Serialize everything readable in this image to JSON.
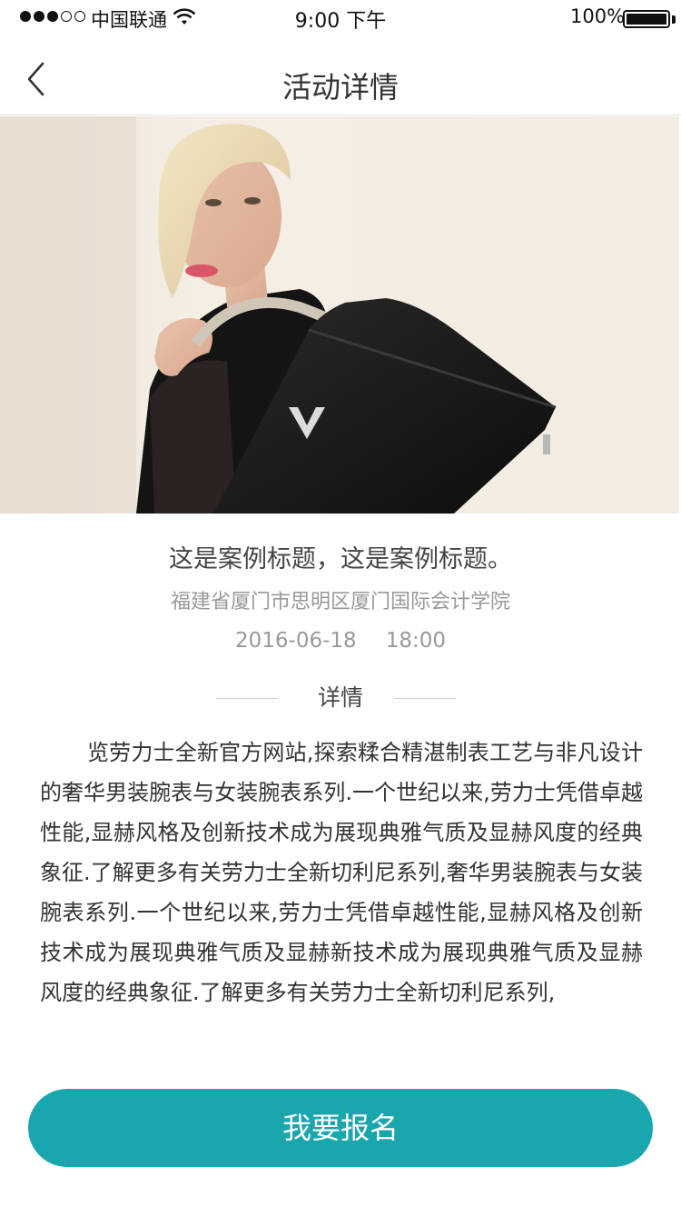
{
  "status_bar": {
    "carrier": "中国联通",
    "time": "9:00 下午",
    "battery_percent": "100%",
    "signal_bars_filled": 3,
    "signal_bars_total": 5
  },
  "nav": {
    "title": "活动详情",
    "back_icon": "chevron-left-icon"
  },
  "event": {
    "title": "这是案例标题，这是案例标题。",
    "address": "福建省厦门市思明区厦门国际会计学院",
    "date": "2016-06-18",
    "time": "18:00"
  },
  "details": {
    "section_label": "详情",
    "body": "览劳力士全新官方网站,探索糅合精湛制表工艺与非凡设计的奢华男装腕表与女装腕表系列.一个世纪以来,劳力士凭借卓越性能,显赫风格及创新技术成为展现典雅气质及显赫风度的经典象征.了解更多有关劳力士全新切利尼系列,奢华男装腕表与女装腕表系列.一个世纪以来,劳力士凭借卓越性能,显赫风格及创新技术成为展现典雅气质及显赫新技术成为展现典雅气质及显赫风度的经典象征.了解更多有关劳力士全新切利尼系列,"
  },
  "actions": {
    "signup_label": "我要报名"
  },
  "colors": {
    "accent": "#1aa6ad",
    "muted_text": "#999999",
    "primary_text": "#333333"
  }
}
